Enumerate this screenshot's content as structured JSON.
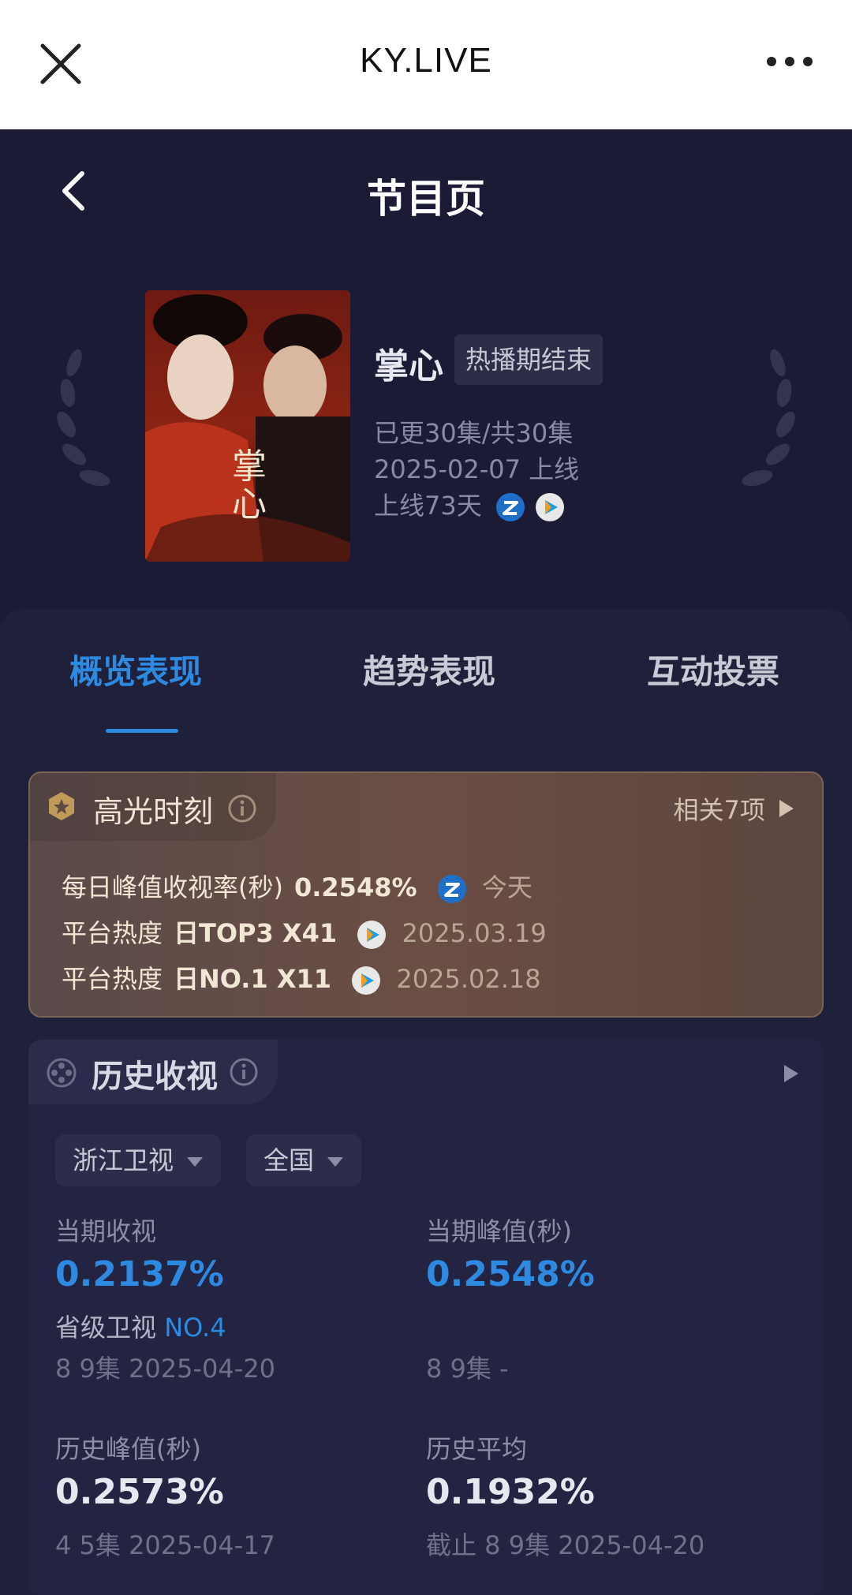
{
  "browser": {
    "title": "KY.LIVE"
  },
  "header": {
    "title": "节目页"
  },
  "show": {
    "name": "掌心",
    "status": "热播期结束",
    "episodes": "已更30集/共30集",
    "premiere": "2025-02-07 上线",
    "days_online": "上线73天",
    "poster_text": "掌心"
  },
  "tabs": [
    {
      "label": "概览表现"
    },
    {
      "label": "趋势表现"
    },
    {
      "label": "互动投票"
    }
  ],
  "highlights": {
    "title": "高光时刻",
    "related": "相关7项",
    "rows": [
      {
        "label": "每日峰值收视率(秒)",
        "value": "0.2548%",
        "date": "今天"
      },
      {
        "label": "平台热度",
        "value": "日TOP3 X41",
        "date": "2025.03.19"
      },
      {
        "label": "平台热度",
        "value": "日NO.1 X11",
        "date": "2025.02.18"
      }
    ]
  },
  "history": {
    "title": "历史收视",
    "filters": [
      "浙江卫视",
      "全国"
    ],
    "stats": {
      "current_rating_label": "当期收视",
      "current_rating": "0.2137%",
      "rank_label": "省级卫视",
      "rank_value": "NO.4",
      "current_rating_sub": "8 9集 2025-04-20",
      "current_peak_label": "当期峰值(秒)",
      "current_peak": "0.2548%",
      "current_peak_sub": "8 9集 -",
      "hist_peak_label": "历史峰值(秒)",
      "hist_peak": "0.2573%",
      "hist_peak_sub": "4 5集 2025-04-17",
      "hist_avg_label": "历史平均",
      "hist_avg": "0.1932%",
      "hist_avg_sub": "截止 8 9集 2025-04-20"
    }
  },
  "colors": {
    "accent": "#2d8ae0",
    "background": "#1b1b35",
    "highlight_card": "#6b4e44"
  }
}
